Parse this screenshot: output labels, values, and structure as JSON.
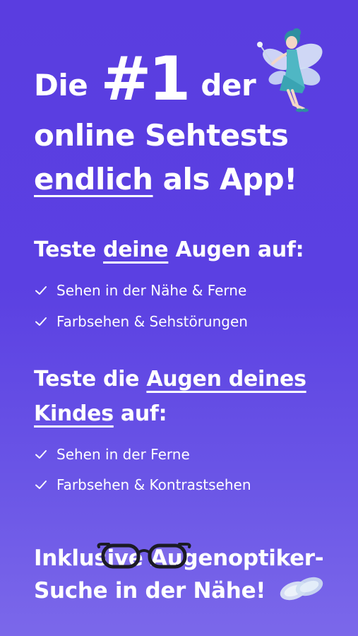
{
  "headline": {
    "line1_pre": "Die",
    "line1_big": "#1",
    "line1_post": "der",
    "line2": "online Sehtests",
    "line3_underlined": "endlich",
    "line3_post": "als App!"
  },
  "section_self": {
    "heading_pre": "Teste",
    "heading_underlined": "deine",
    "heading_post": "Augen auf:",
    "items": [
      "Sehen in der Nähe & Ferne",
      "Farbsehen & Sehstörungen"
    ]
  },
  "section_child": {
    "heading_pre": "Teste die",
    "heading_underlined_1": "Augen deines",
    "heading_underlined_2": "Kindes",
    "heading_post": "auf:",
    "items": [
      "Sehen in der Ferne",
      "Farbsehen & Kontrastsehen"
    ]
  },
  "footer": {
    "line1": "Inklusive Augenoptiker-",
    "line2": "Suche in der Nähe!"
  },
  "icons": {
    "fairy": "fairy-illustration",
    "check": "checkmark-icon",
    "glasses": "glasses-illustration",
    "lenses": "contact-lenses-illustration"
  },
  "colors": {
    "background_top": "#5a3de0",
    "background_bottom": "#7b68ea",
    "text": "#ffffff"
  }
}
